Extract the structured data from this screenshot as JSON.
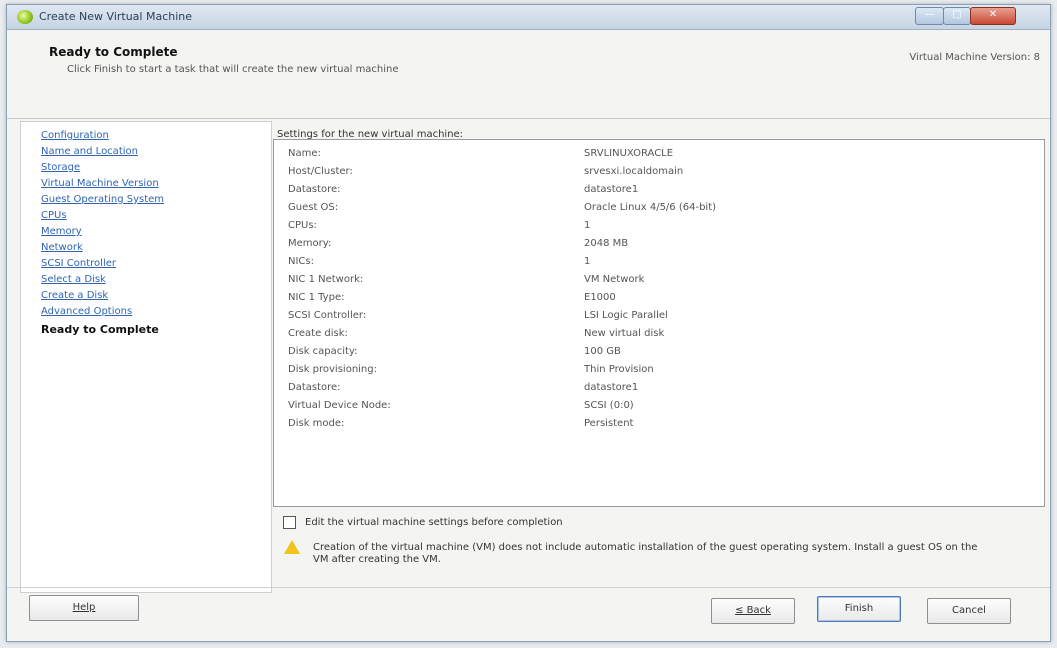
{
  "window": {
    "title": "Create New Virtual Machine",
    "min_label": "—",
    "max_label": "□",
    "close_label": "✕"
  },
  "header": {
    "title": "Ready to Complete",
    "subtitle": "Click Finish to start a task that will create the new virtual machine",
    "version": "Virtual Machine Version: 8"
  },
  "nav": {
    "items": [
      {
        "label": "Configuration"
      },
      {
        "label": "Name and Location"
      },
      {
        "label": "Storage"
      },
      {
        "label": "Virtual Machine Version"
      },
      {
        "label": "Guest Operating System"
      },
      {
        "label": "CPUs"
      },
      {
        "label": "Memory"
      },
      {
        "label": "Network"
      },
      {
        "label": "SCSI Controller"
      },
      {
        "label": "Select a Disk"
      },
      {
        "label": "Create a Disk"
      },
      {
        "label": "Advanced Options"
      },
      {
        "label": "Ready to Complete"
      }
    ]
  },
  "settings": {
    "label": "Settings for the new virtual machine:",
    "rows": [
      {
        "key": "Name:",
        "value": "SRVLINUXORACLE"
      },
      {
        "key": "Host/Cluster:",
        "value": "srvesxi.localdomain"
      },
      {
        "key": "Datastore:",
        "value": "datastore1"
      },
      {
        "key": "Guest OS:",
        "value": "Oracle Linux 4/5/6 (64-bit)"
      },
      {
        "key": "CPUs:",
        "value": "1"
      },
      {
        "key": "Memory:",
        "value": "2048 MB"
      },
      {
        "key": "NICs:",
        "value": "1"
      },
      {
        "key": "NIC 1 Network:",
        "value": "VM Network"
      },
      {
        "key": "NIC 1 Type:",
        "value": "E1000"
      },
      {
        "key": "SCSI Controller:",
        "value": "LSI Logic Parallel"
      },
      {
        "key": "Create disk:",
        "value": "New virtual disk"
      },
      {
        "key": "Disk capacity:",
        "value": "100 GB"
      },
      {
        "key": "Disk provisioning:",
        "value": "Thin Provision"
      },
      {
        "key": "Datastore:",
        "value": "datastore1"
      },
      {
        "key": "Virtual Device Node:",
        "value": "SCSI (0:0)"
      },
      {
        "key": "Disk mode:",
        "value": "Persistent"
      }
    ]
  },
  "edit_checkbox_label": "Edit the virtual machine settings before completion",
  "warning_text": "Creation of the virtual machine (VM) does not include automatic installation of the guest operating system. Install a guest OS on the VM after creating the VM.",
  "buttons": {
    "help": "Help",
    "back": "≤ Back",
    "finish": "Finish",
    "cancel": "Cancel"
  }
}
